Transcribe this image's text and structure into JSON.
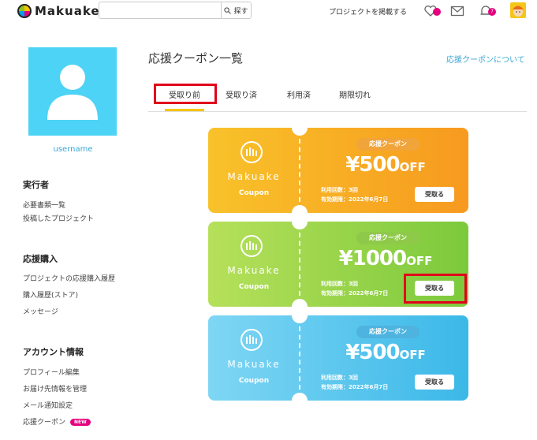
{
  "header": {
    "logo_text": "Makuake",
    "search": {
      "placeholder": "",
      "button_label": "探す"
    },
    "post_link": "プロジェクトを掲載する",
    "notification_count": "7"
  },
  "sidebar": {
    "username": "username",
    "sections": [
      {
        "title": "実行者",
        "links": [
          "必要書類一覧",
          "投稿したプロジェクト"
        ]
      },
      {
        "title": "応援購入",
        "links": [
          "プロジェクトの応援購入履歴",
          "購入履歴(ストア)",
          "メッセージ"
        ]
      },
      {
        "title": "アカウント情報",
        "links": [
          "プロフィール編集",
          "お届け先情報を管理",
          "メール通知設定",
          "応援クーポン"
        ]
      }
    ],
    "new_badge": "NEW"
  },
  "main": {
    "title": "応援クーポン一覧",
    "about_link": "応援クーポンについて",
    "tabs": [
      {
        "label": "受取り前",
        "active": true
      },
      {
        "label": "受取り済"
      },
      {
        "label": "利用済"
      },
      {
        "label": "期限切れ"
      }
    ]
  },
  "coupons": [
    {
      "brand": "Makuake",
      "brand_sub": "Coupon",
      "pill": "応援クーポン",
      "amount": "¥500",
      "off": "OFF",
      "uses": "利用回数：3回",
      "expiry": "有効期限：2022年6月7日",
      "button": "受取る",
      "color_left": "#f8c22a",
      "color_right": "#f79a1f",
      "pill_color": "#f0a43a"
    },
    {
      "brand": "Makuake",
      "brand_sub": "Coupon",
      "pill": "応援クーポン",
      "amount": "¥1000",
      "off": "OFF",
      "uses": "利用回数：3回",
      "expiry": "有効期限：2022年6月7日",
      "button": "受取る",
      "color_left": "#b6e05a",
      "color_right": "#7cc93c",
      "pill_color": "#8fc94a"
    },
    {
      "brand": "Makuake",
      "brand_sub": "Coupon",
      "pill": "応援クーポン",
      "amount": "¥500",
      "off": "OFF",
      "uses": "利用回数：3回",
      "expiry": "有効期限：2022年6月7日",
      "button": "受取る",
      "color_left": "#7fd6f4",
      "color_right": "#3bb8e8",
      "pill_color": "#4fb3df"
    }
  ]
}
